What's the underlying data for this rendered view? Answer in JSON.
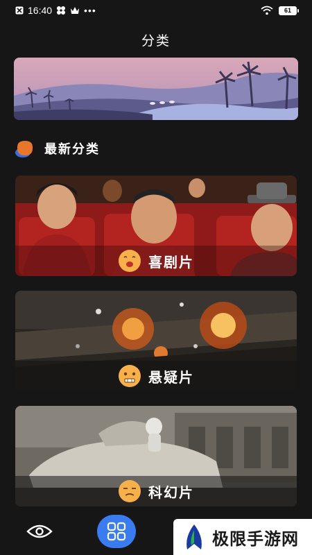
{
  "status": {
    "time": "16:40",
    "battery": "61"
  },
  "header": {
    "title": "分类"
  },
  "section": {
    "title": "最新分类"
  },
  "categories": [
    {
      "label": "喜剧片"
    },
    {
      "label": "悬疑片"
    },
    {
      "label": "科幻片"
    }
  ],
  "watermark": {
    "text": "极限手游网"
  },
  "colors": {
    "accent": "#3b7bf0",
    "background": "#161616",
    "emoji": "#f7b04a",
    "section_icon": "#e8772b"
  }
}
